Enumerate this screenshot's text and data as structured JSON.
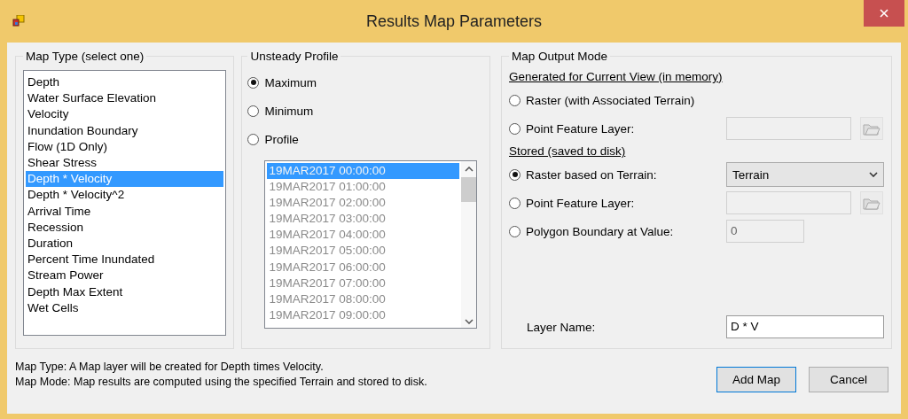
{
  "window": {
    "title": "Results Map Parameters"
  },
  "map_type": {
    "title": "Map Type (select one)",
    "items": [
      {
        "label": "Depth",
        "selected": false
      },
      {
        "label": "Water Surface Elevation",
        "selected": false
      },
      {
        "label": "Velocity",
        "selected": false
      },
      {
        "label": "Inundation Boundary",
        "selected": false
      },
      {
        "label": "Flow (1D Only)",
        "selected": false
      },
      {
        "label": "Shear Stress",
        "selected": false
      },
      {
        "label": "Depth * Velocity",
        "selected": true
      },
      {
        "label": "Depth * Velocity^2",
        "selected": false
      },
      {
        "label": "Arrival Time",
        "selected": false
      },
      {
        "label": "Recession",
        "selected": false
      },
      {
        "label": "Duration",
        "selected": false
      },
      {
        "label": "Percent Time Inundated",
        "selected": false
      },
      {
        "label": "Stream Power",
        "selected": false
      },
      {
        "label": "Depth Max Extent",
        "selected": false
      },
      {
        "label": "Wet Cells",
        "selected": false
      }
    ]
  },
  "unsteady_profile": {
    "title": "Unsteady Profile",
    "options": [
      {
        "label": "Maximum",
        "selected": true
      },
      {
        "label": "Minimum",
        "selected": false
      },
      {
        "label": "Profile",
        "selected": false
      }
    ],
    "times": {
      "disabled": true,
      "items": [
        {
          "label": "19MAR2017 00:00:00",
          "selected": true
        },
        {
          "label": "19MAR2017 01:00:00",
          "selected": false
        },
        {
          "label": "19MAR2017 02:00:00",
          "selected": false
        },
        {
          "label": "19MAR2017 03:00:00",
          "selected": false
        },
        {
          "label": "19MAR2017 04:00:00",
          "selected": false
        },
        {
          "label": "19MAR2017 05:00:00",
          "selected": false
        },
        {
          "label": "19MAR2017 06:00:00",
          "selected": false
        },
        {
          "label": "19MAR2017 07:00:00",
          "selected": false
        },
        {
          "label": "19MAR2017 08:00:00",
          "selected": false
        },
        {
          "label": "19MAR2017 09:00:00",
          "selected": false
        }
      ]
    }
  },
  "map_output_mode": {
    "title": "Map Output Mode",
    "sections": [
      {
        "heading": "Generated for Current View (in memory)",
        "options": [
          {
            "label": "Raster (with Associated Terrain)",
            "selected": false,
            "kind": "plain"
          },
          {
            "label": "Point Feature Layer:",
            "selected": false,
            "kind": "path"
          }
        ]
      },
      {
        "heading": "Stored (saved to disk)",
        "options": [
          {
            "label": "Raster based on Terrain:",
            "selected": true,
            "kind": "dropdown",
            "value": "Terrain"
          },
          {
            "label": "Point Feature Layer:",
            "selected": false,
            "kind": "path"
          },
          {
            "label": "Polygon Boundary at Value:",
            "selected": false,
            "kind": "number",
            "value": "0"
          }
        ]
      }
    ],
    "layer_name": {
      "label": "Layer Name:",
      "value": "D * V"
    }
  },
  "messages": [
    "Map Type: A Map layer will be created for Depth times Velocity.",
    "Map Mode: Map results are computed using the specified Terrain and stored to disk."
  ],
  "buttons": [
    {
      "label": "Add Map",
      "default": true
    },
    {
      "label": "Cancel",
      "default": false
    }
  ]
}
